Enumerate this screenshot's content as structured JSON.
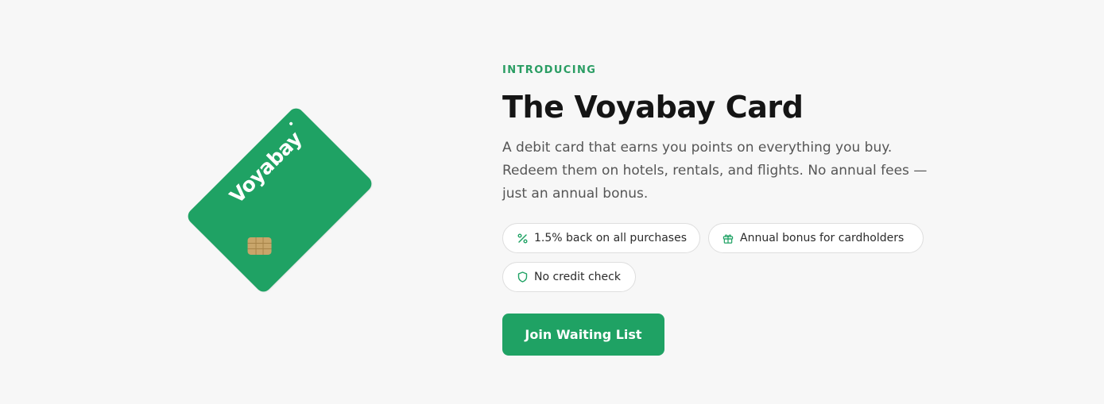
{
  "card": {
    "brand": "Voyabay",
    "color": "#1fa264",
    "chip_color": "#c8a56a"
  },
  "hero": {
    "eyebrow": "INTRODUCING",
    "title": "The Voyabay Card",
    "description": "A debit card that earns you points on everything you buy. Redeem them on hotels, rentals, and flights. No annual fees — just an annual bonus.",
    "features": [
      {
        "icon": "percent-icon",
        "label": "1.5% back on all purchases"
      },
      {
        "icon": "gift-icon",
        "label": "Annual bonus for cardholders"
      },
      {
        "icon": "shield-icon",
        "label": "No credit check"
      }
    ],
    "cta_label": "Join Waiting List"
  },
  "colors": {
    "accent": "#1fa264",
    "eyebrow": "#2a9d63",
    "title": "#151515",
    "body_text": "#565656",
    "background": "#f7f7f7"
  }
}
